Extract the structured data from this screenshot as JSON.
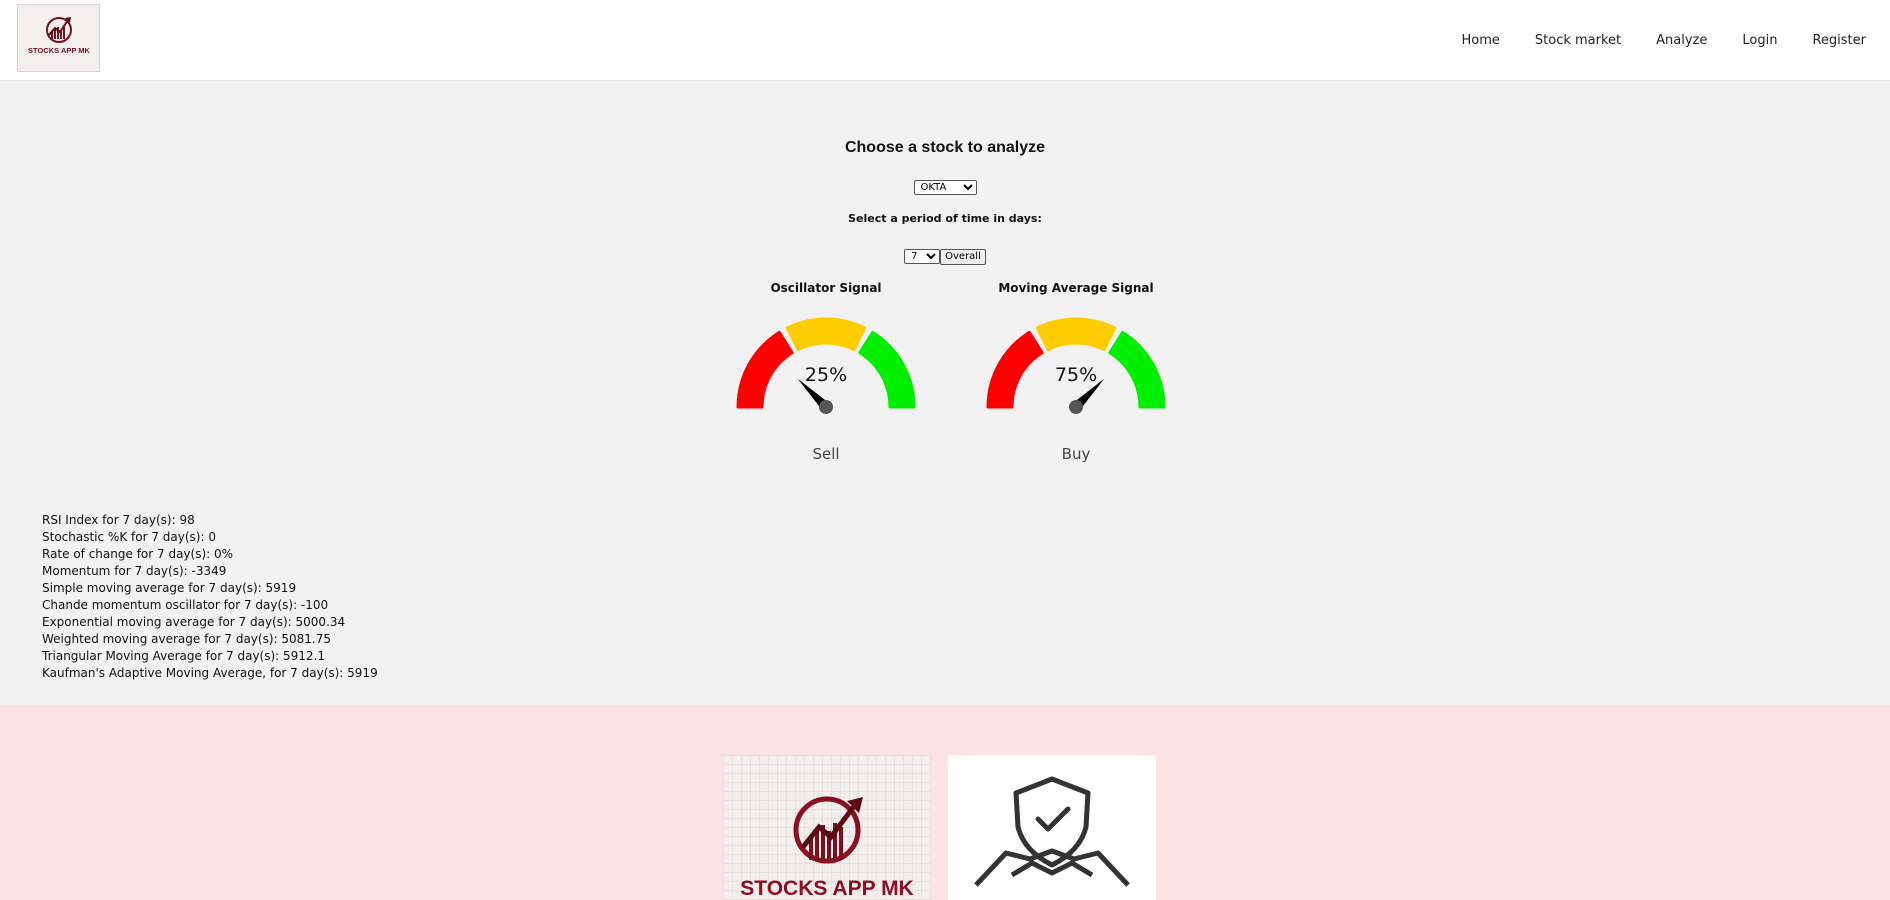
{
  "header": {
    "logo_text": "STOCKS APP MK",
    "nav": [
      {
        "label": "Home"
      },
      {
        "label": "Stock market"
      },
      {
        "label": "Analyze"
      },
      {
        "label": "Login"
      },
      {
        "label": "Register"
      }
    ]
  },
  "analyze": {
    "title": "Choose a stock to analyze",
    "stock_selected": "OKTA",
    "period_label": "Select a period of time in days:",
    "days_selected": "7",
    "overall_button": "Overall"
  },
  "gauges": [
    {
      "title": "Oscillator Signal",
      "percent_text": "25%",
      "value": 0.25,
      "result": "Sell"
    },
    {
      "title": "Moving Average Signal",
      "percent_text": "75%",
      "value": 0.75,
      "result": "Buy"
    }
  ],
  "gauge_colors": {
    "sell": "#ff0000",
    "neutral": "#ffcc00",
    "buy": "#00ee00",
    "needle": "#000000",
    "hub": "#555555"
  },
  "metrics": [
    "RSI Index for 7 day(s): 98",
    "Stochastic %K for 7 day(s): 0",
    "Rate of change for 7 day(s): 0%",
    "Momentum for 7 day(s): -3349",
    "Simple moving average for 7 day(s): 5919",
    "Chande momentum oscillator for 7 day(s): -100",
    "Exponential moving average for 7 day(s): 5000.34",
    "Weighted moving average for 7 day(s): 5081.75",
    "Triangular Moving Average for 7 day(s): 5912.1",
    "Kaufman's Adaptive Moving Average, for 7 day(s): 5919"
  ],
  "footer": {
    "logo_text": "STOCKS APP MK"
  },
  "colors": {
    "header_bg": "#ffffff",
    "main_bg": "#f2f2f2",
    "footer_bg": "#fde2e4",
    "logo_maroon": "#7a1020"
  }
}
